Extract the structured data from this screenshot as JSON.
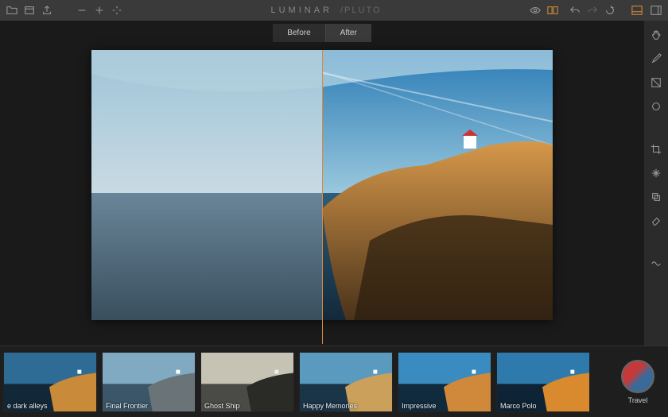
{
  "app": {
    "name": "LUMINAR",
    "subtitle": "/PLUTO"
  },
  "compare": {
    "before": "Before",
    "after": "After"
  },
  "presets": [
    {
      "label": "e dark alleys",
      "filter": "sat12"
    },
    {
      "label": "Final Frontier",
      "filter": "cool"
    },
    {
      "label": "Ghost Ship",
      "filter": "desat"
    },
    {
      "label": "Happy Memories",
      "filter": "warm"
    },
    {
      "label": "Impressive",
      "filter": "sat"
    },
    {
      "label": "Marco Polo",
      "filter": "sat2"
    }
  ],
  "category": {
    "label": "Travel"
  },
  "colors": {
    "accent": "#d88a3a"
  }
}
